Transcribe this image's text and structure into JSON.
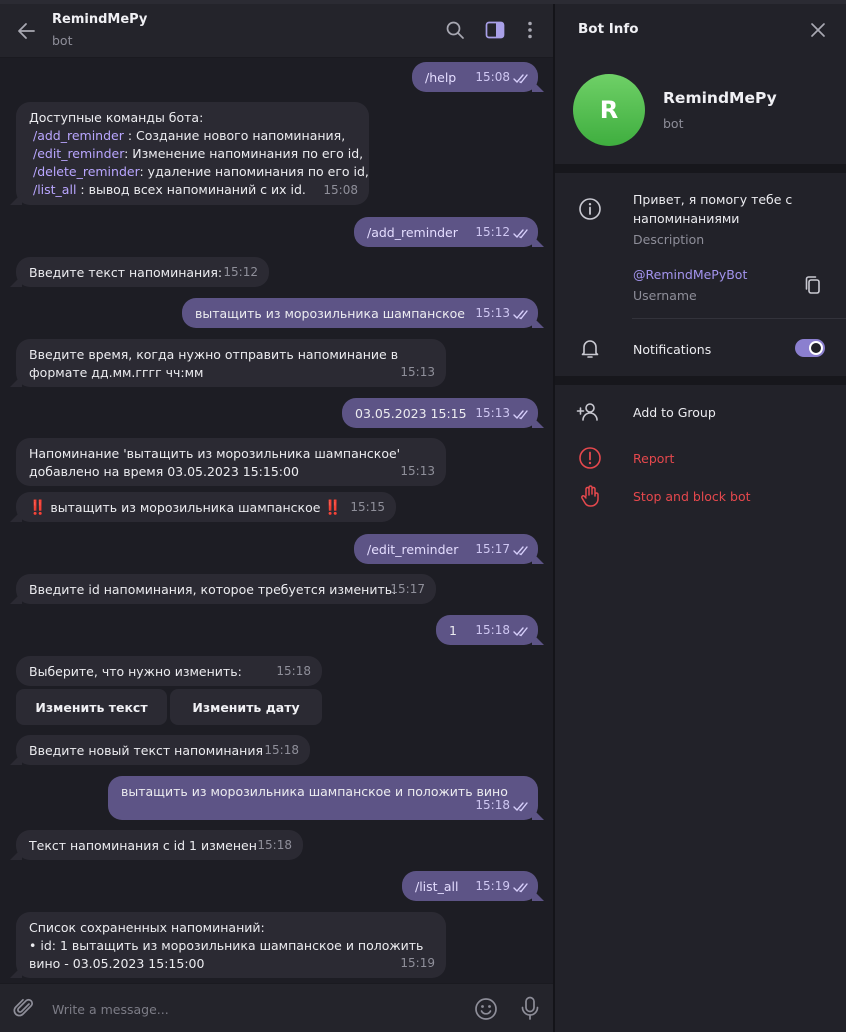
{
  "header": {
    "title": "RemindMePy",
    "subtitle": "bot"
  },
  "messages": {
    "m1": {
      "text": "/help",
      "time": "15:08"
    },
    "m2": {
      "intro": "Доступные команды бота:",
      "cmd1": "/add_reminder",
      "desc1": " : Создание нового напоминания,",
      "cmd2": "/edit_reminder",
      "desc2": ": Изменение напоминания по его id,",
      "cmd3": "/delete_reminder",
      "desc3": ": удаление напоминания по его id,",
      "cmd4": "/list_all",
      "desc4": " : вывод всех напоминаний с их id.",
      "time": "15:08"
    },
    "m3": {
      "text": "/add_reminder",
      "time": "15:12"
    },
    "m4": {
      "text": "Введите текст напоминания:",
      "time": "15:12"
    },
    "m5": {
      "text": "вытащить из морозильника шампанское",
      "time": "15:13"
    },
    "m6": {
      "line1": "Введите время, когда нужно отправить напоминание в",
      "line2": "формате дд.мм.гггг чч:мм",
      "time": "15:13"
    },
    "m7": {
      "text": "03.05.2023 15:15",
      "time": "15:13"
    },
    "m8": {
      "line1": "Напоминание 'вытащить из морозильника шампанское'",
      "line2": "добавлено на время 03.05.2023 15:15:00",
      "time": "15:13"
    },
    "m9": {
      "bang": "‼️",
      "text": " вытащить из морозильника шампанское ",
      "time": "15:15"
    },
    "m10": {
      "text": "/edit_reminder",
      "time": "15:17"
    },
    "m11": {
      "text": "Введите id напоминания, которое требуется изменить:",
      "time": "15:17"
    },
    "m12": {
      "text": "1",
      "time": "15:18"
    },
    "m13": {
      "text": "Выберите, что нужно изменить:",
      "time": "15:18"
    },
    "keyboard": {
      "btn1": "Изменить текст",
      "btn2": "Изменить дату"
    },
    "m14": {
      "text": "Введите новый текст напоминания",
      "time": "15:18"
    },
    "m15": {
      "text": "вытащить из морозильника шампанское и положить вино",
      "time": "15:18"
    },
    "m16": {
      "text": "Текст напоминания с id 1 изменен",
      "time": "15:18"
    },
    "m17": {
      "text": "/list_all",
      "time": "15:19"
    },
    "m18": {
      "line1": "Список сохраненных напоминаний:",
      "line2": "• id: 1    вытащить из морозильника шампанское и положить",
      "line3": "вино - 03.05.2023 15:15:00",
      "time": "15:19"
    }
  },
  "composer": {
    "placeholder": "Write a message..."
  },
  "panel": {
    "title": "Bot Info",
    "avatar_letter": "R",
    "name": "RemindMePy",
    "sub": "bot",
    "description_line1": "Привет, я помогу тебе с",
    "description_line2": "напоминаниями",
    "description_label": "Description",
    "username": "@RemindMePyBot",
    "username_label": "Username",
    "notifications": "Notifications",
    "notifications_on": true,
    "add_to_group": "Add to Group",
    "report": "Report",
    "stop_block": "Stop and block bot"
  },
  "colors": {
    "accent": "#8b7fcf",
    "outgoing_bubble": "#5d5486",
    "incoming_bubble": "#2b2a33",
    "danger": "#e5484d",
    "avatar": "#4cb944"
  },
  "icons": [
    "back-arrow-icon",
    "search-icon",
    "sidebar-toggle-icon",
    "more-vertical-icon",
    "read-ticks-icon",
    "paperclip-icon",
    "emoji-icon",
    "microphone-icon",
    "close-icon",
    "info-icon",
    "copy-icon",
    "bell-icon",
    "add-user-icon",
    "report-icon",
    "stop-hand-icon"
  ]
}
